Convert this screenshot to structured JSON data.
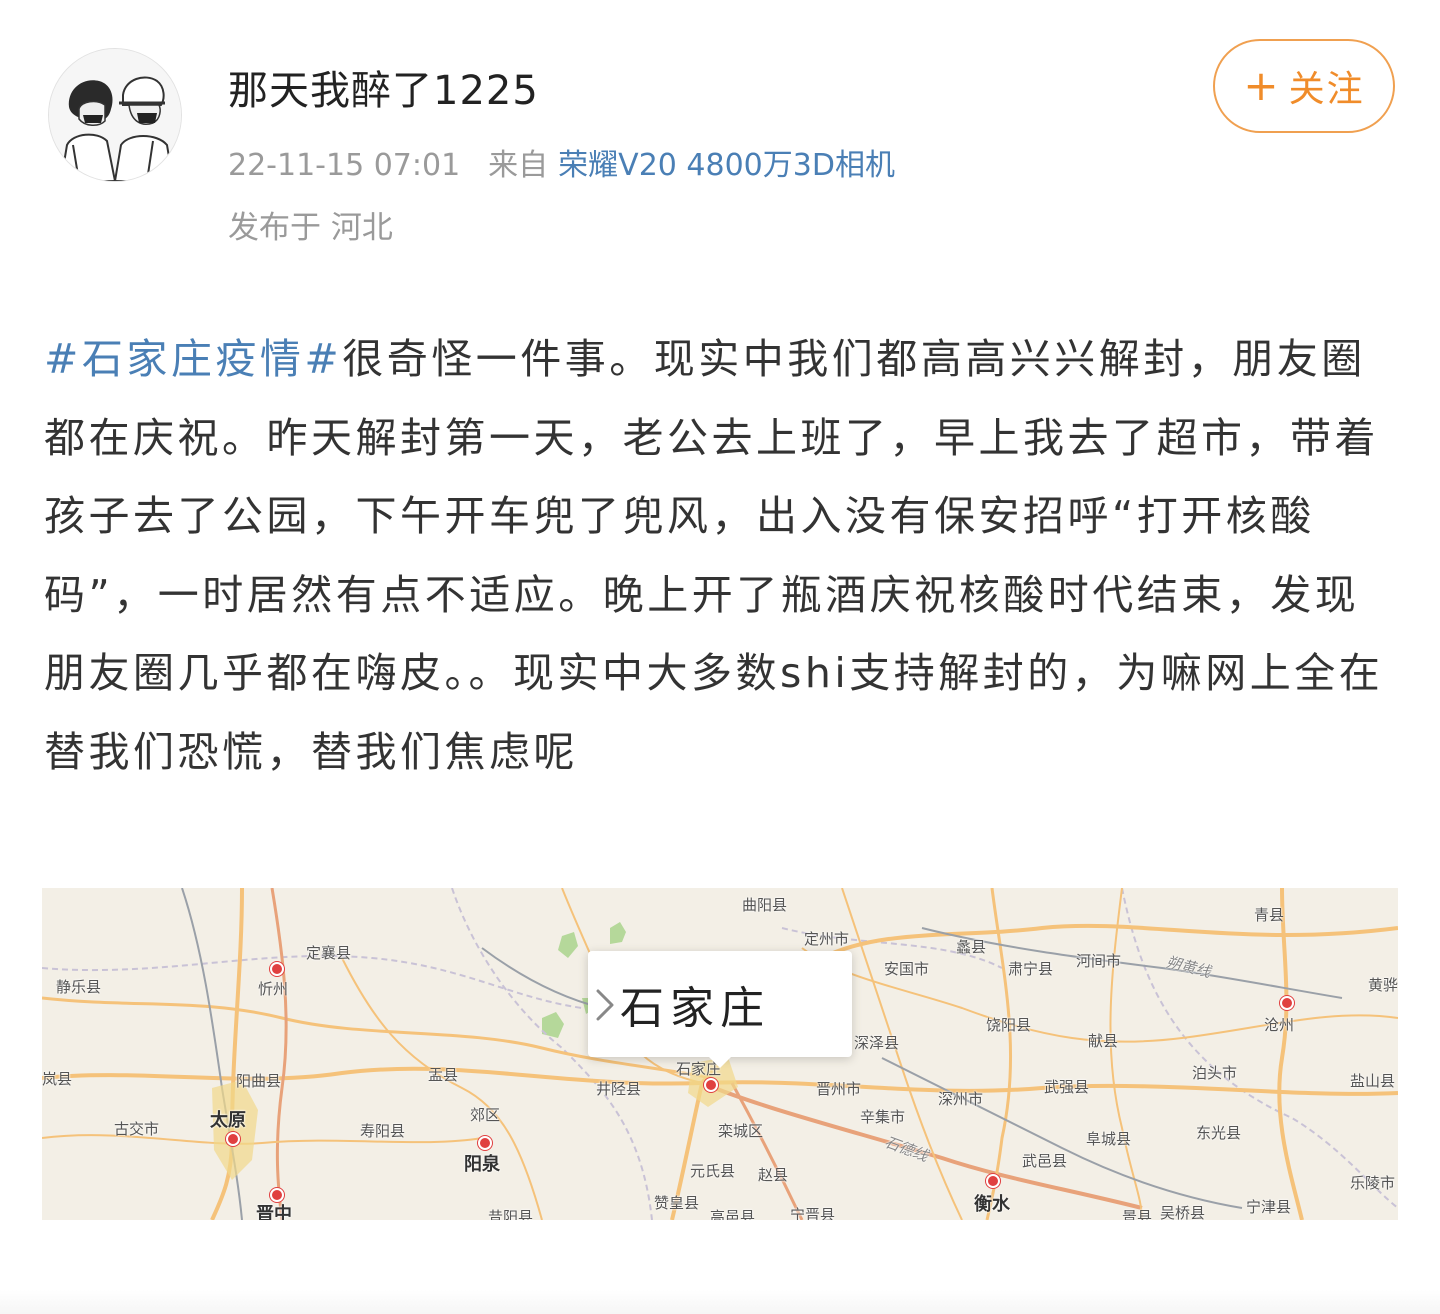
{
  "post": {
    "username": "那天我醉了1225",
    "timestamp": "22-11-15 07:01",
    "source_label": "来自",
    "device": "荣耀V20 4800万3D相机",
    "location": "发布于 河北",
    "follow_label": "关注",
    "follow_plus": "+",
    "hashtag": "#石家庄疫情#",
    "body": "很奇怪一件事。现实中我们都高高兴兴解封，朋友圈都在庆祝。昨天解封第一天，老公去上班了，早上我去了超市，带着孩子去了公园，下午开车兜了兜风，出入没有保安招呼“打开核酸码”，一时居然有点不适应。晚上开了瓶酒庆祝核酸时代结束，发现朋友圈几乎都在嗨皮。。现实中大多数shi支持解封的，为嘛网上全在替我们恐慌，替我们焦虑呢"
  },
  "map": {
    "callout_place": "石家庄",
    "colors": {
      "land": "#f3efe6",
      "road_orange": "#f5c27a",
      "road_red": "#e8a27a",
      "boundary": "#c9c2d6",
      "green": "#b5d89a",
      "pin": "#e04040"
    },
    "labels": [
      "曲阳县",
      "青县",
      "定州市",
      "蠡县",
      "定襄县",
      "安国市",
      "肃宁县",
      "河间市",
      "朔黄线",
      "黄骅",
      "静乐县",
      "忻州",
      "沧州",
      "饶阳县",
      "献县",
      "深泽县",
      "岚县",
      "阳曲县",
      "盂县",
      "井陉县",
      "石家庄",
      "晋州市",
      "武强县",
      "泊头市",
      "盐山县",
      "古交市",
      "太原",
      "郊区",
      "寿阳县",
      "栾城区",
      "辛集市",
      "深州市",
      "阜城县",
      "东光县",
      "阳泉",
      "石德线",
      "元氏县",
      "赵县",
      "武邑县",
      "乐陵市",
      "晋中",
      "昔阳县",
      "赞皇县",
      "高邑县",
      "宁晋县",
      "衡水",
      "景县",
      "吴桥县",
      "宁津县"
    ]
  }
}
